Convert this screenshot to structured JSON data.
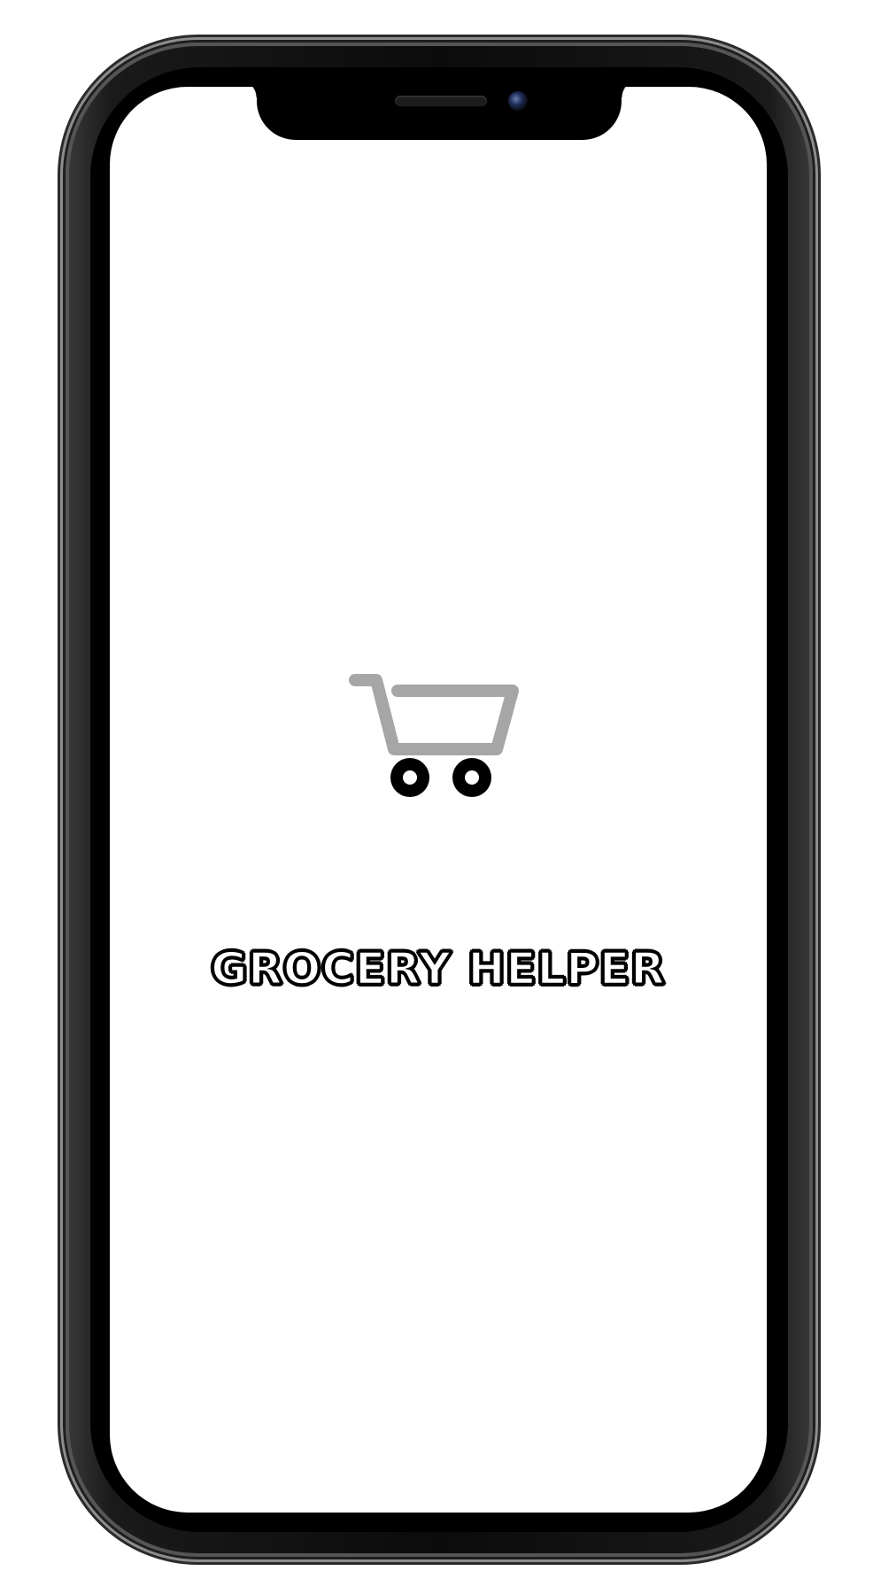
{
  "app": {
    "title": "GROCERY HELPER",
    "logo_icon": "shopping-cart-icon"
  },
  "colors": {
    "cart_basket": "#a6a6a6",
    "cart_wheels": "#000000",
    "title_outline": "#000000",
    "screen_background": "#ffffff"
  }
}
